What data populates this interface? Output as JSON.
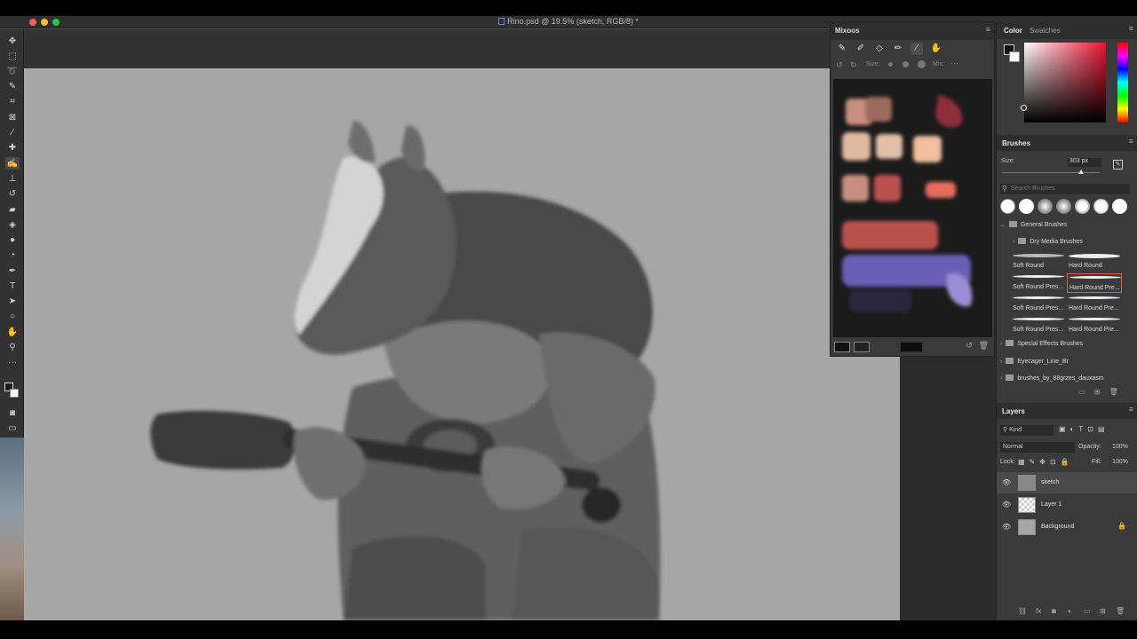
{
  "window": {
    "title": "Rino.psd @ 19.5% (sketch, RGB/8) *"
  },
  "toolbar": {
    "tools": [
      "move-icon",
      "marquee-icon",
      "lasso-icon",
      "quick-select-icon",
      "crop-icon",
      "frame-icon",
      "eyedropper-icon",
      "healing-icon",
      "brush-icon",
      "stamp-icon",
      "history-brush-icon",
      "eraser-icon",
      "paint-bucket-icon",
      "blur-icon",
      "dodge-icon",
      "pen-icon",
      "type-icon",
      "path-select-icon",
      "shape-icon",
      "hand-icon",
      "zoom-icon",
      "more-icon"
    ],
    "active_tool": "brush-icon"
  },
  "mixoos": {
    "title": "Mixoos",
    "tools": [
      "brush-icon",
      "mix-brush-icon",
      "eraser-icon",
      "smudge-icon",
      "picker-icon",
      "hand-icon"
    ],
    "size_label": "Size:",
    "mix_label": "Mix:",
    "colors": {
      "skin1": "#c88e7f",
      "skin2": "#9d6a5c",
      "skin3": "#e0b8a0",
      "red1": "#b9514e",
      "red2": "#8e2f3a",
      "purple1": "#6b5fb5",
      "purple2": "#9b8ed6",
      "dark": "#2b2640",
      "accent": "#e76a5d"
    }
  },
  "color_panel": {
    "tabs": [
      "Color",
      "Swatches"
    ],
    "active_tab": "Color",
    "hue_color": "#e8132f"
  },
  "brushes": {
    "title": "Brushes",
    "size_label": "Size:",
    "size_value": "303 px",
    "search_placeholder": "Search Brushes",
    "groups": [
      {
        "name": "General Brushes",
        "open": true
      },
      {
        "name": "Dry Media Brushes",
        "open": false
      },
      {
        "name": "Special Effects Brushes",
        "open": false
      },
      {
        "name": "Eyecager_Line_Br",
        "open": false
      },
      {
        "name": "brushes_by_88grzes_dauxasm",
        "open": false
      }
    ],
    "items": [
      {
        "name": "Soft Round",
        "selected": false
      },
      {
        "name": "Hard Round",
        "selected": false
      },
      {
        "name": "Soft Round Pres...",
        "selected": false
      },
      {
        "name": "Hard Round Pre...",
        "selected": true
      },
      {
        "name": "Soft Round Pres...",
        "selected": false
      },
      {
        "name": "Hard Round Pre...",
        "selected": false
      },
      {
        "name": "Soft Round Pres...",
        "selected": false
      },
      {
        "name": "Hard Round Pre...",
        "selected": false
      }
    ]
  },
  "layers": {
    "title": "Layers",
    "filter_label": "Kind",
    "blend_mode": "Normal",
    "opacity_label": "Opacity:",
    "opacity_value": "100%",
    "lock_label": "Lock:",
    "fill_label": "Fill:",
    "fill_value": "100%",
    "items": [
      {
        "name": "sketch",
        "active": true,
        "locked": false
      },
      {
        "name": "Layer 1",
        "active": false,
        "locked": false
      },
      {
        "name": "Background",
        "active": false,
        "locked": true
      }
    ]
  }
}
